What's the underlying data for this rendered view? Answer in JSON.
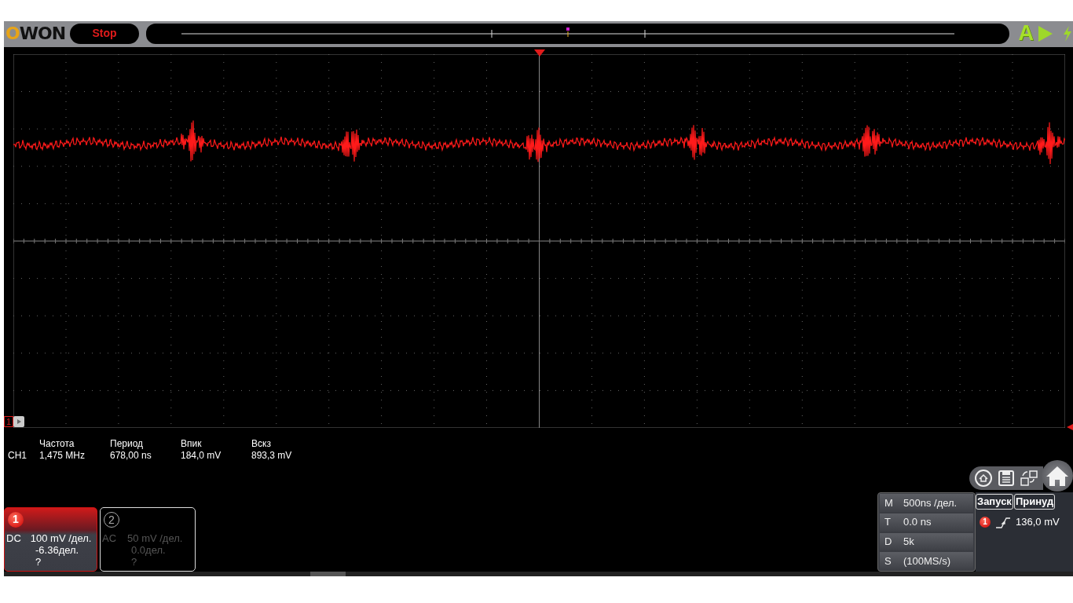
{
  "brand": "OWON",
  "run_state": "Stop",
  "top_buttons": [
    {
      "kind": "auto",
      "label": "A"
    },
    {
      "kind": "run"
    },
    {
      "kind": "single"
    }
  ],
  "trace_marker": "1",
  "measurements": {
    "channel": "CH1",
    "items": [
      {
        "label": "Частота",
        "value": "1,475 MHz"
      },
      {
        "label": "Период",
        "value": "678,00 ns"
      },
      {
        "label": "Впик",
        "value": "184,0 mV"
      },
      {
        "label": "Вскз",
        "value": "893,3 mV"
      }
    ]
  },
  "channels": [
    {
      "number": "1",
      "coupling": "DC",
      "scale": "100 mV /дел.",
      "offset": "-6.36дел.",
      "probe": "?",
      "selected": true
    },
    {
      "number": "2",
      "coupling": "AC",
      "scale": "50 mV /дел.",
      "offset": "0.0дел.",
      "probe": "?",
      "selected": false
    }
  ],
  "timebase": [
    {
      "key": "M",
      "value": "500ns /дел."
    },
    {
      "key": "T",
      "value": "0.0 ns"
    },
    {
      "key": "D",
      "value": "5k"
    },
    {
      "key": "S",
      "value": "(100MS/s)"
    }
  ],
  "trigger": {
    "tabs": [
      {
        "label": "Запуск"
      },
      {
        "label": "Принуд"
      }
    ],
    "source": "1",
    "level": "136,0 mV"
  }
}
